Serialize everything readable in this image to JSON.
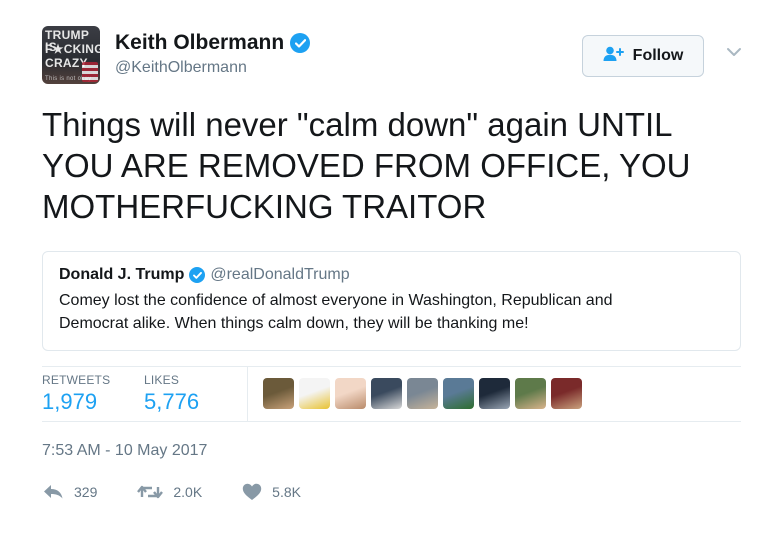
{
  "author": {
    "avatar_text": [
      "TRUMP IS",
      "F★CKING",
      "CRAZY",
      "This is not okay"
    ],
    "name": "Keith Olbermann",
    "handle": "@KeithOlbermann"
  },
  "follow": {
    "label": "Follow"
  },
  "tweet": {
    "text": "Things will never \"calm down\" again UNTIL\nYOU ARE REMOVED FROM OFFICE, YOU\nMOTHERFUCKING TRAITOR"
  },
  "quote": {
    "name": "Donald J. Trump",
    "handle": "@realDonaldTrump",
    "text": "Comey lost the confidence of almost everyone in Washington, Republican and\nDemocrat alike. When things calm down, they will be thanking me!"
  },
  "stats": {
    "retweets_label": "RETWEETS",
    "retweets_value": "1,979",
    "likes_label": "LIKES",
    "likes_value": "5,776"
  },
  "likers": [
    {
      "name": "liker-1",
      "colors": [
        "#6b5a3a",
        "#c9a27a"
      ]
    },
    {
      "name": "liker-2",
      "colors": [
        "#f4f4f4",
        "#e8c230"
      ]
    },
    {
      "name": "liker-3",
      "colors": [
        "#f2d7c6",
        "#b98b6a"
      ]
    },
    {
      "name": "liker-4",
      "colors": [
        "#3a4a5e",
        "#d8d8d8"
      ]
    },
    {
      "name": "liker-5",
      "colors": [
        "#7a8794",
        "#c7b49a"
      ]
    },
    {
      "name": "liker-6",
      "colors": [
        "#5a7a96",
        "#2d6e2e"
      ]
    },
    {
      "name": "liker-7",
      "colors": [
        "#1e2a3a",
        "#9aa6b5"
      ]
    },
    {
      "name": "liker-8",
      "colors": [
        "#5e7a4a",
        "#d9b48c"
      ]
    },
    {
      "name": "liker-9",
      "colors": [
        "#7a2a2a",
        "#caa27e"
      ]
    }
  ],
  "timestamp": "7:53 AM - 10 May 2017",
  "actions": {
    "reply_count": "329",
    "retweet_count": "2.0K",
    "like_count": "5.8K"
  },
  "colors": {
    "accent": "#1da1f2",
    "muted": "#657786",
    "text": "#14171a",
    "border": "#e1e8ed"
  }
}
